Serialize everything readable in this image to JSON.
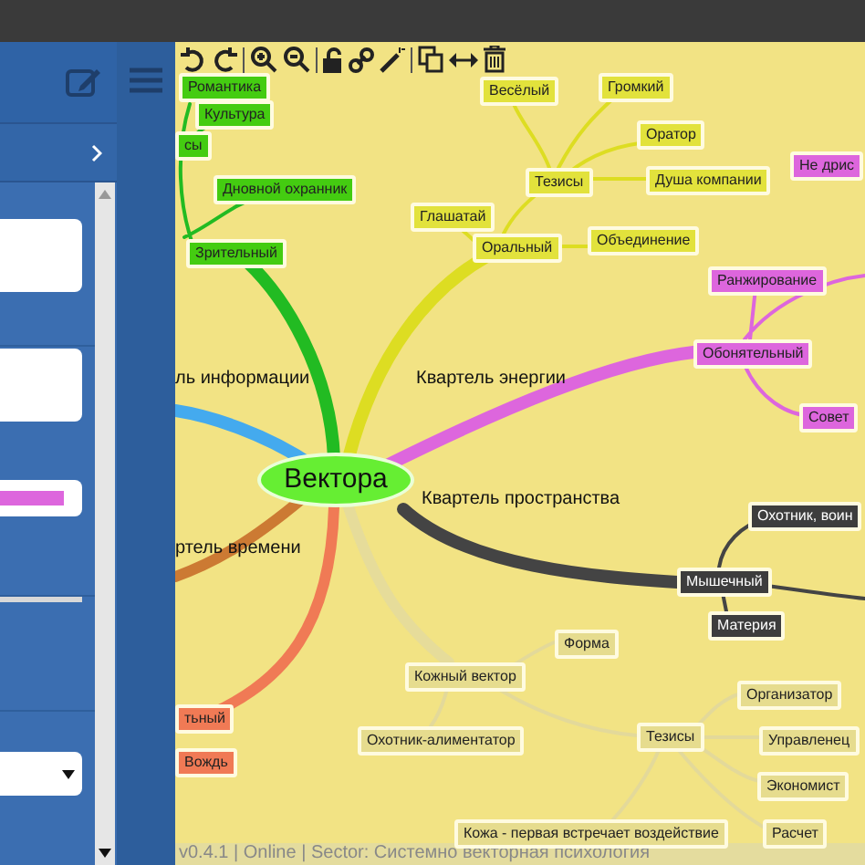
{
  "root": {
    "text": "Вектора"
  },
  "quarters": [
    {
      "text": "ль информации"
    },
    {
      "text": "Квартель энергии"
    },
    {
      "text": "Квартель пространства"
    },
    {
      "text": "ртель времени"
    }
  ],
  "nodes": [
    {
      "text": "Романтика",
      "color": "#44cc11"
    },
    {
      "text": "Культура",
      "color": "#44cc11"
    },
    {
      "text": "сы",
      "color": "#44cc11"
    },
    {
      "text": "Дновной охранник",
      "color": "#44cc11"
    },
    {
      "text": "Зрительный",
      "color": "#44cc11"
    },
    {
      "text": "Весёлый",
      "color": "#e2e23c"
    },
    {
      "text": "Громкий",
      "color": "#e2e23c"
    },
    {
      "text": "Оратор",
      "color": "#e2e23c"
    },
    {
      "text": "Тезисы",
      "color": "#e2e23c"
    },
    {
      "text": "Душа компании",
      "color": "#e2e23c"
    },
    {
      "text": "Глашатай",
      "color": "#e2e23c"
    },
    {
      "text": "Оральный",
      "color": "#e2e23c"
    },
    {
      "text": "Объединение",
      "color": "#e2e23c"
    },
    {
      "text": "Не дрис",
      "color": "#dd66dd"
    },
    {
      "text": "Ранжирование",
      "color": "#dd66dd"
    },
    {
      "text": "Обонятельный",
      "color": "#dd66dd"
    },
    {
      "text": "Совет",
      "color": "#dd66dd"
    },
    {
      "text": "Охотник, воин",
      "color": "#3d3d3d"
    },
    {
      "text": "Мышечный",
      "color": "#3d3d3d"
    },
    {
      "text": "Материя",
      "color": "#3d3d3d"
    },
    {
      "text": "Форма",
      "color": "#e6dc8e"
    },
    {
      "text": "Кожный вектор",
      "color": "#e6dc8e"
    },
    {
      "text": "Охотник-алиментатор",
      "color": "#e6dc8e"
    },
    {
      "text": "Тезисы",
      "color": "#e6dc8e"
    },
    {
      "text": "Организатор",
      "color": "#e6dc8e"
    },
    {
      "text": "Управленец",
      "color": "#e6dc8e"
    },
    {
      "text": "Экономист",
      "color": "#e6dc8e"
    },
    {
      "text": "Расчет",
      "color": "#e6dc8e"
    },
    {
      "text": "Кожа - первая встречает воздействие",
      "color": "#e6dc8e"
    },
    {
      "text": "тьный",
      "color": "#f07a55"
    },
    {
      "text": "Вождь",
      "color": "#f07a55"
    }
  ],
  "color_swatch": {
    "color": "#dd66dd"
  },
  "status_bar": "v0.4.1 | Online | Sector: Системно векторная психология"
}
